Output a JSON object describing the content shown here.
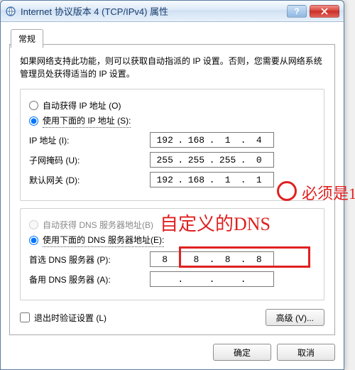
{
  "window": {
    "title": "Internet 协议版本 4 (TCP/IPv4) 属性"
  },
  "tab": {
    "label": "常规"
  },
  "intro": "如果网络支持此功能，则可以获取自动指派的 IP 设置。否则，您需要从网络系统管理员处获得适当的 IP 设置。",
  "ip": {
    "auto": "自动获得 IP 地址 (O)",
    "manual": "使用下面的 IP 地址 (S):",
    "addr_lbl": "IP 地址 (I):",
    "mask_lbl": "子网掩码 (U):",
    "gw_lbl": "默认网关 (D):",
    "addr": [
      "192",
      "168",
      "1",
      "4"
    ],
    "mask": [
      "255",
      "255",
      "255",
      "0"
    ],
    "gw": [
      "192",
      "168",
      "1",
      "1"
    ]
  },
  "dns": {
    "auto": "自动获得 DNS 服务器地址(B)",
    "manual": "使用下面的 DNS 服务器地址(E):",
    "pref_lbl": "首选 DNS 服务器 (P):",
    "alt_lbl": "备用 DNS 服务器 (A):",
    "pref": [
      "8",
      "8",
      "8",
      "8"
    ],
    "alt": [
      "",
      "",
      "",
      ""
    ]
  },
  "validate": "退出时验证设置 (L)",
  "buttons": {
    "advanced": "高级 (V)...",
    "ok": "确定",
    "cancel": "取消"
  },
  "anno": {
    "must1": "必须是1",
    "customdns": "自定义的DNS"
  }
}
